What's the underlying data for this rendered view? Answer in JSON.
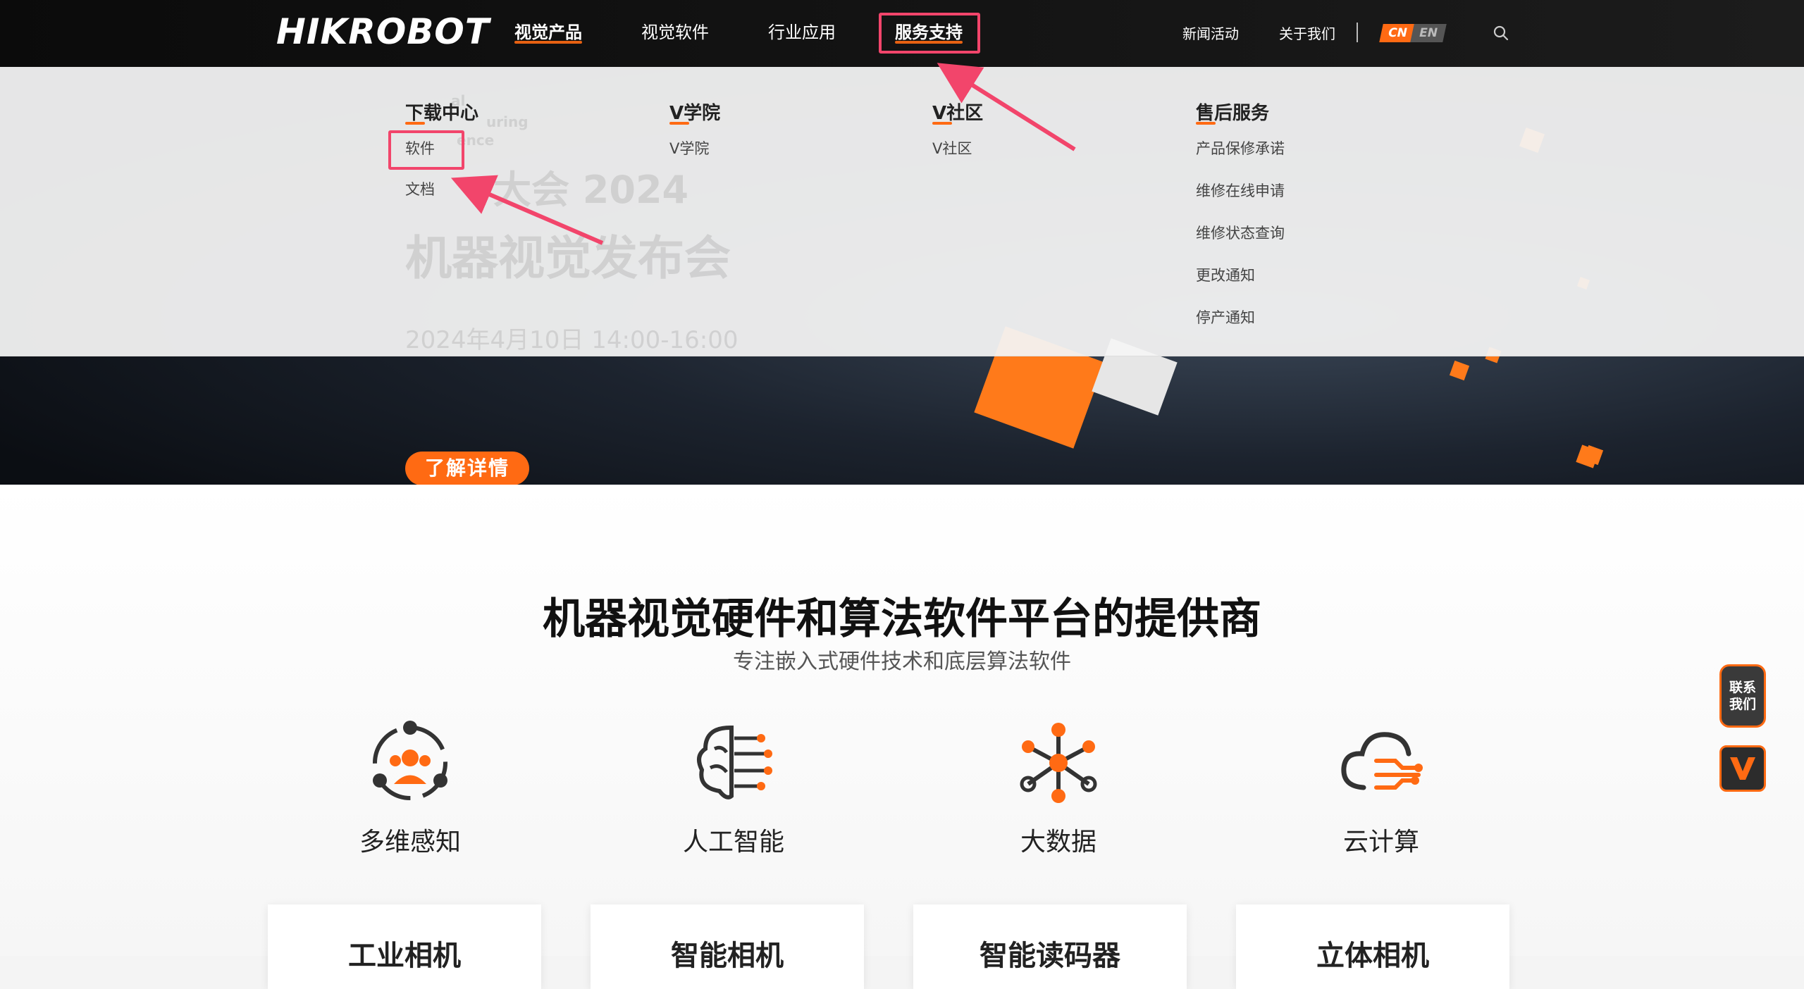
{
  "logo": "HIKROBOT",
  "nav": {
    "items": [
      "视觉产品",
      "视觉软件",
      "行业应用",
      "服务支持"
    ],
    "right": [
      "新闻活动",
      "关于我们"
    ],
    "lang_cn": "CN",
    "lang_en": "EN"
  },
  "hero": {
    "ghost_lines": [
      "al",
      "uring",
      "ence",
      "大会 2024",
      "机器视觉发布会",
      "2024年4月10日 14:00-16:00"
    ],
    "button": "了解详情"
  },
  "dropdown": {
    "download": {
      "title": "下载中心",
      "links": [
        "软件",
        "文档"
      ]
    },
    "academy": {
      "title": "V学院",
      "links": [
        "V学院"
      ]
    },
    "community": {
      "title": "V社区",
      "links": [
        "V社区"
      ]
    },
    "aftersales": {
      "title": "售后服务",
      "links": [
        "产品保修承诺",
        "维修在线申请",
        "维修状态查询",
        "更改通知",
        "停产通知"
      ]
    }
  },
  "main": {
    "headline": "机器视觉硬件和算法软件平台的提供商",
    "subline": "专注嵌入式硬件技术和底层算法软件",
    "features": [
      "多维感知",
      "人工智能",
      "大数据",
      "云计算"
    ],
    "cards": [
      "工业相机",
      "智能相机",
      "智能读码器",
      "立体相机"
    ]
  },
  "side": {
    "contact_line1": "联系",
    "contact_line2": "我们"
  },
  "colors": {
    "accent": "#ff6a13",
    "highlight": "#f2456b"
  },
  "icons": [
    "search-icon",
    "multi-sense-icon",
    "ai-brain-icon",
    "big-data-icon",
    "cloud-compute-icon",
    "v-logo-icon"
  ]
}
